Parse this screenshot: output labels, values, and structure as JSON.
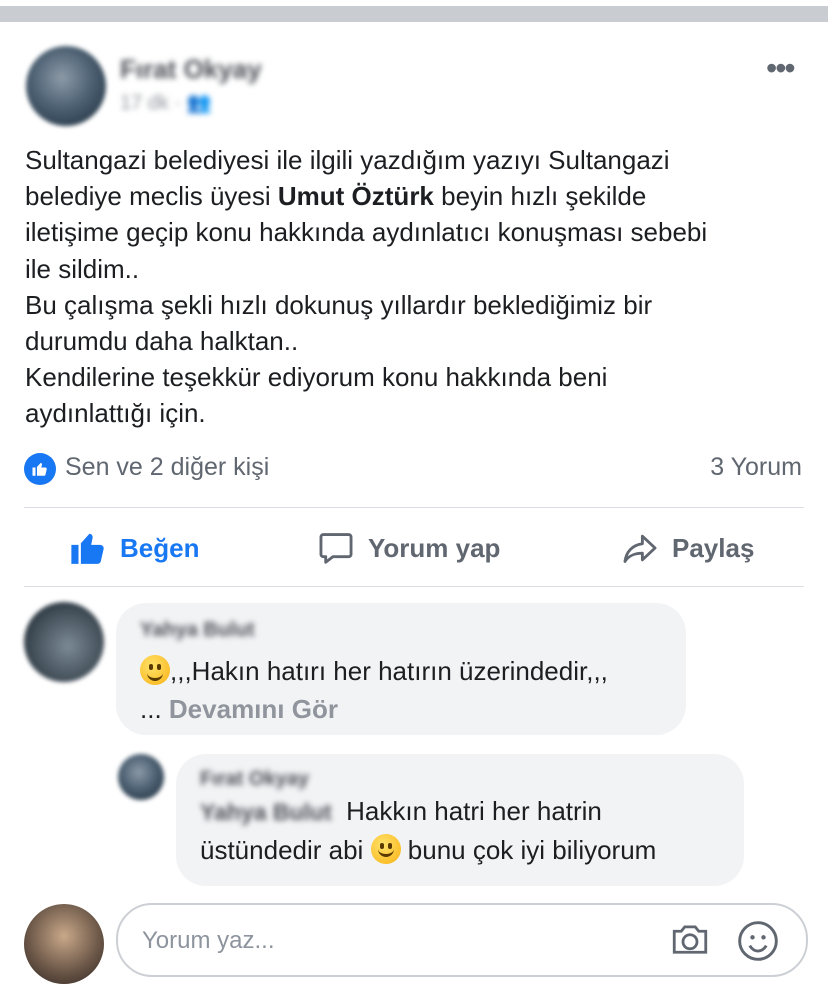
{
  "post": {
    "author": "Fırat Okyay",
    "meta": "17 dk · ",
    "more_icon": "more-horizontal-icon",
    "text_lines": {
      "l1": "Sultangazi belediyesi ile ilgili yazdığım yazıyı Sultangazi",
      "l2a": "belediye meclis üyesi ",
      "l2b": "Umut Öztürk",
      "l2c": " beyin hızlı şekilde",
      "l3": "iletişime geçip konu hakkında aydınlatıcı konuşması sebebi",
      "l4": "ile sildim..",
      "l5": "Bu çalışma şekli hızlı dokunuş yıllardır beklediğimiz bir",
      "l6": "durumdu daha halktan..",
      "l7": "Kendilerine teşekkür ediyorum konu hakkında beni",
      "l8": "aydınlattığı için."
    }
  },
  "reactions": {
    "text": "Sen ve 2 diğer kişi",
    "comment_count": "3 Yorum"
  },
  "actions": {
    "like": "Beğen",
    "comment": "Yorum yap",
    "share": "Paylaş"
  },
  "comments": [
    {
      "author": "Yahya Bulut",
      "text": ",,,Hakın hatırı her hatırın üzerindedir,,,",
      "ellipsis": "... ",
      "see_more": "Devamını Gör"
    },
    {
      "author": "Fırat Okyay",
      "mention": "Yahya Bulut",
      "text_a": "Hakkın hatri her hatrin",
      "text_b1": "üstündedir abi ",
      "text_b2": " bunu çok iyi biliyorum"
    }
  ],
  "composer": {
    "placeholder": "Yorum yaz..."
  },
  "colors": {
    "accent": "#1877f2",
    "bubble": "#f2f3f5",
    "secondary_text": "#606770"
  }
}
